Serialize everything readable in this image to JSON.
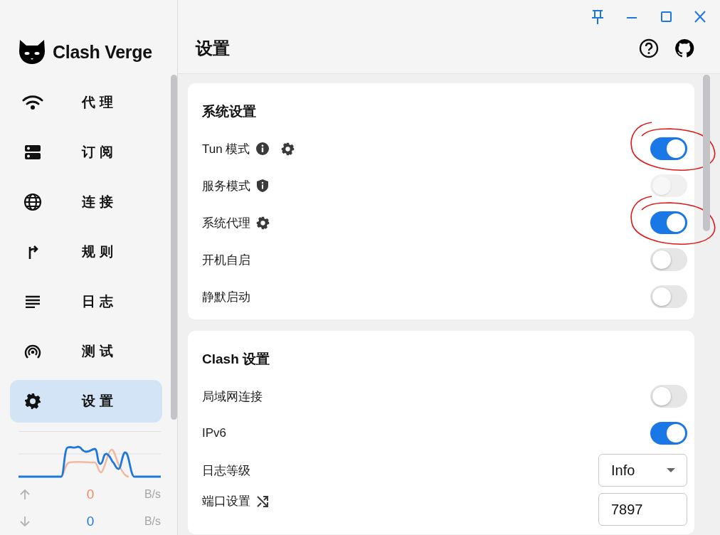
{
  "app": {
    "name": "Clash Verge"
  },
  "nav": [
    {
      "label": "代理",
      "selected": false
    },
    {
      "label": "订阅",
      "selected": false
    },
    {
      "label": "连接",
      "selected": false
    },
    {
      "label": "规则",
      "selected": false
    },
    {
      "label": "日志",
      "selected": false
    },
    {
      "label": "测试",
      "selected": false
    },
    {
      "label": "设置",
      "selected": true
    }
  ],
  "traffic": {
    "upload": {
      "value": "0",
      "unit": "B/s"
    },
    "download": {
      "value": "0",
      "unit": "B/s"
    }
  },
  "page": {
    "title": "设置"
  },
  "sections": [
    {
      "title": "系统设置",
      "rows": [
        {
          "label": "Tun 模式",
          "kind": "toggle",
          "on": true,
          "disabled": false,
          "highlighted": true
        },
        {
          "label": "服务模式",
          "kind": "toggle",
          "on": false,
          "disabled": true,
          "highlighted": false
        },
        {
          "label": "系统代理",
          "kind": "toggle",
          "on": true,
          "disabled": false,
          "highlighted": true
        },
        {
          "label": "开机自启",
          "kind": "toggle",
          "on": false,
          "disabled": false,
          "highlighted": false
        },
        {
          "label": "静默启动",
          "kind": "toggle",
          "on": false,
          "disabled": false,
          "highlighted": false
        }
      ]
    },
    {
      "title": "Clash 设置",
      "rows": [
        {
          "label": "局域网连接",
          "kind": "toggle",
          "on": false,
          "disabled": false,
          "highlighted": false
        },
        {
          "label": "IPv6",
          "kind": "toggle",
          "on": true,
          "disabled": false,
          "highlighted": false
        },
        {
          "label": "日志等级",
          "kind": "select",
          "value": "Info"
        },
        {
          "label": "端口设置",
          "kind": "input",
          "value": "7897"
        }
      ]
    }
  ]
}
